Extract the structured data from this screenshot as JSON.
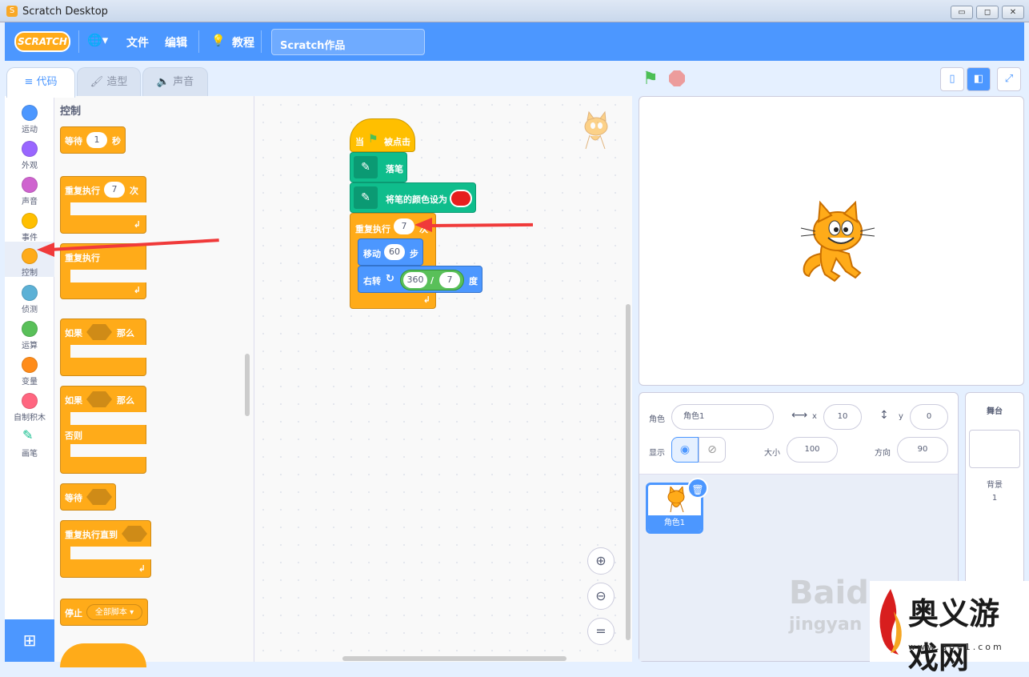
{
  "window": {
    "title": "Scratch Desktop",
    "controls": [
      "▭",
      "◻",
      "✕"
    ]
  },
  "menubar": {
    "logo": "SCRATCH",
    "language_icon": "🌐▾",
    "file": "文件",
    "edit": "编辑",
    "tutorials": "教程",
    "project_name": "Scratch作品"
  },
  "tabs": [
    {
      "label": "代码",
      "active": true
    },
    {
      "label": "造型",
      "active": false
    },
    {
      "label": "声音",
      "active": false
    }
  ],
  "categories": [
    {
      "label": "运动",
      "color": "#4c97ff"
    },
    {
      "label": "外观",
      "color": "#9966ff"
    },
    {
      "label": "声音",
      "color": "#cf63cf"
    },
    {
      "label": "事件",
      "color": "#ffbf00"
    },
    {
      "label": "控制",
      "color": "#ffab19",
      "selected": true
    },
    {
      "label": "侦测",
      "color": "#5cb1d6"
    },
    {
      "label": "运算",
      "color": "#59c059"
    },
    {
      "label": "变量",
      "color": "#ff8c1a"
    },
    {
      "label": "自制积木",
      "color": "#ff6680"
    },
    {
      "label": "画笔",
      "color": "pen-icon"
    }
  ],
  "palette": {
    "title": "控制",
    "wait": {
      "label": "等待",
      "value": "1",
      "unit": "秒"
    },
    "repeat": {
      "label": "重复执行",
      "value": "7",
      "unit": "次"
    },
    "forever": {
      "label": "重复执行"
    },
    "if_then": {
      "if": "如果",
      "then": "那么"
    },
    "if_else": {
      "if": "如果",
      "then": "那么",
      "else": "否则"
    },
    "wait_until": {
      "label": "等待"
    },
    "repeat_until": {
      "label": "重复执行直到"
    },
    "stop": {
      "label": "停止",
      "option": "全部脚本 ▾"
    }
  },
  "script": {
    "hat": {
      "when": "当",
      "clicked": "被点击"
    },
    "pen_down": "落笔",
    "set_color": "将笔的颜色设为",
    "repeat": {
      "label": "重复执行",
      "value": "7",
      "unit": "次"
    },
    "move": {
      "label": "移动",
      "value": "60",
      "unit": "步"
    },
    "turn": {
      "label": "右转",
      "a": "360",
      "op": "/",
      "b": "7",
      "unit": "度"
    }
  },
  "zoom": [
    "⊕",
    "⊖",
    "="
  ],
  "sprite_info": {
    "sprite_label": "角色",
    "sprite_name": "角色1",
    "x_label": "x",
    "x": "10",
    "y_label": "y",
    "y": "0",
    "show_label": "显示",
    "size_label": "大小",
    "size": "100",
    "direction_label": "方向",
    "direction": "90"
  },
  "sprites": [
    {
      "name": "角色1"
    }
  ],
  "stage_panel": {
    "title": "舞台",
    "backdrop_label": "背景",
    "backdrop_count": "1"
  },
  "watermark": {
    "baidu": "Baidu",
    "jingyan": "jingyan",
    "logo_text": "奥义游戏网",
    "url": "www.aoe1.com"
  },
  "colors": {
    "accent": "#4c97ff",
    "control": "#ffab19",
    "pen": "#0fbd8c",
    "red_swatch": "#e61e1e"
  }
}
